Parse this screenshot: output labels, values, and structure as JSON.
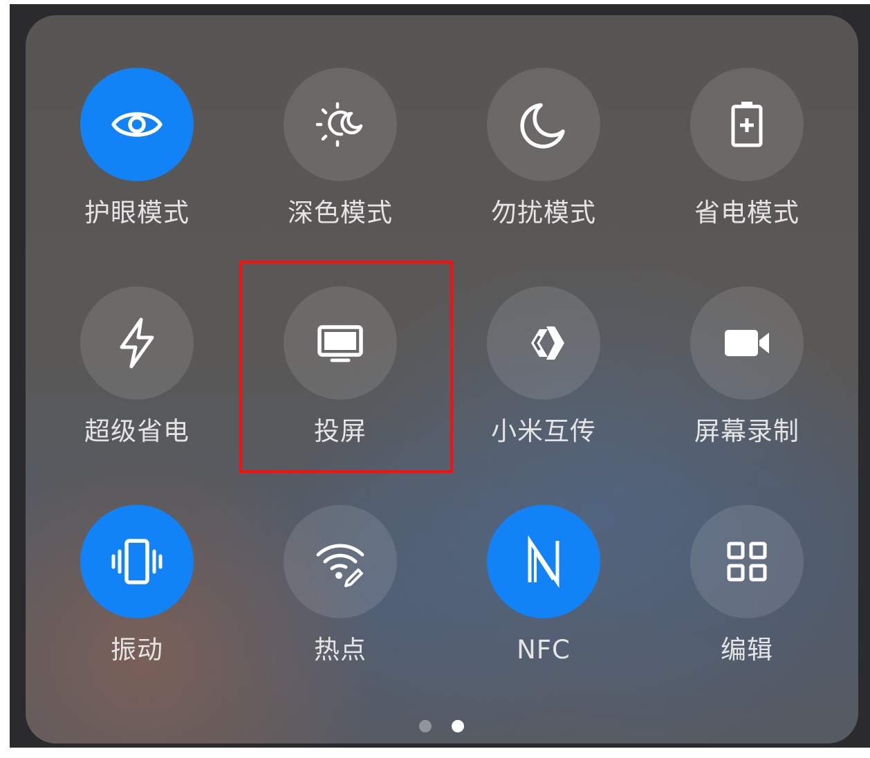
{
  "toggles": [
    {
      "label": "护眼模式",
      "icon": "eye-icon",
      "active": true
    },
    {
      "label": "深色模式",
      "icon": "sun-moon-icon",
      "active": false
    },
    {
      "label": "勿扰模式",
      "icon": "moon-icon",
      "active": false
    },
    {
      "label": "省电模式",
      "icon": "battery-plus-icon",
      "active": false
    },
    {
      "label": "超级省电",
      "icon": "lightning-icon",
      "active": false
    },
    {
      "label": "投屏",
      "icon": "monitor-icon",
      "active": false,
      "highlighted": true
    },
    {
      "label": "小米互传",
      "icon": "share-arrow-icon",
      "active": false
    },
    {
      "label": "屏幕录制",
      "icon": "video-camera-icon",
      "active": false
    },
    {
      "label": "振动",
      "icon": "vibrate-icon",
      "active": true
    },
    {
      "label": "热点",
      "icon": "hotspot-icon",
      "active": false
    },
    {
      "label": "NFC",
      "icon": "nfc-icon",
      "active": true
    },
    {
      "label": "编辑",
      "icon": "grid-icon",
      "active": false
    }
  ],
  "pagination": {
    "pages": 2,
    "current": 2
  },
  "colors": {
    "active": "#1283f6",
    "highlight": "#ff0d0d",
    "label": "#e4e4e4"
  }
}
